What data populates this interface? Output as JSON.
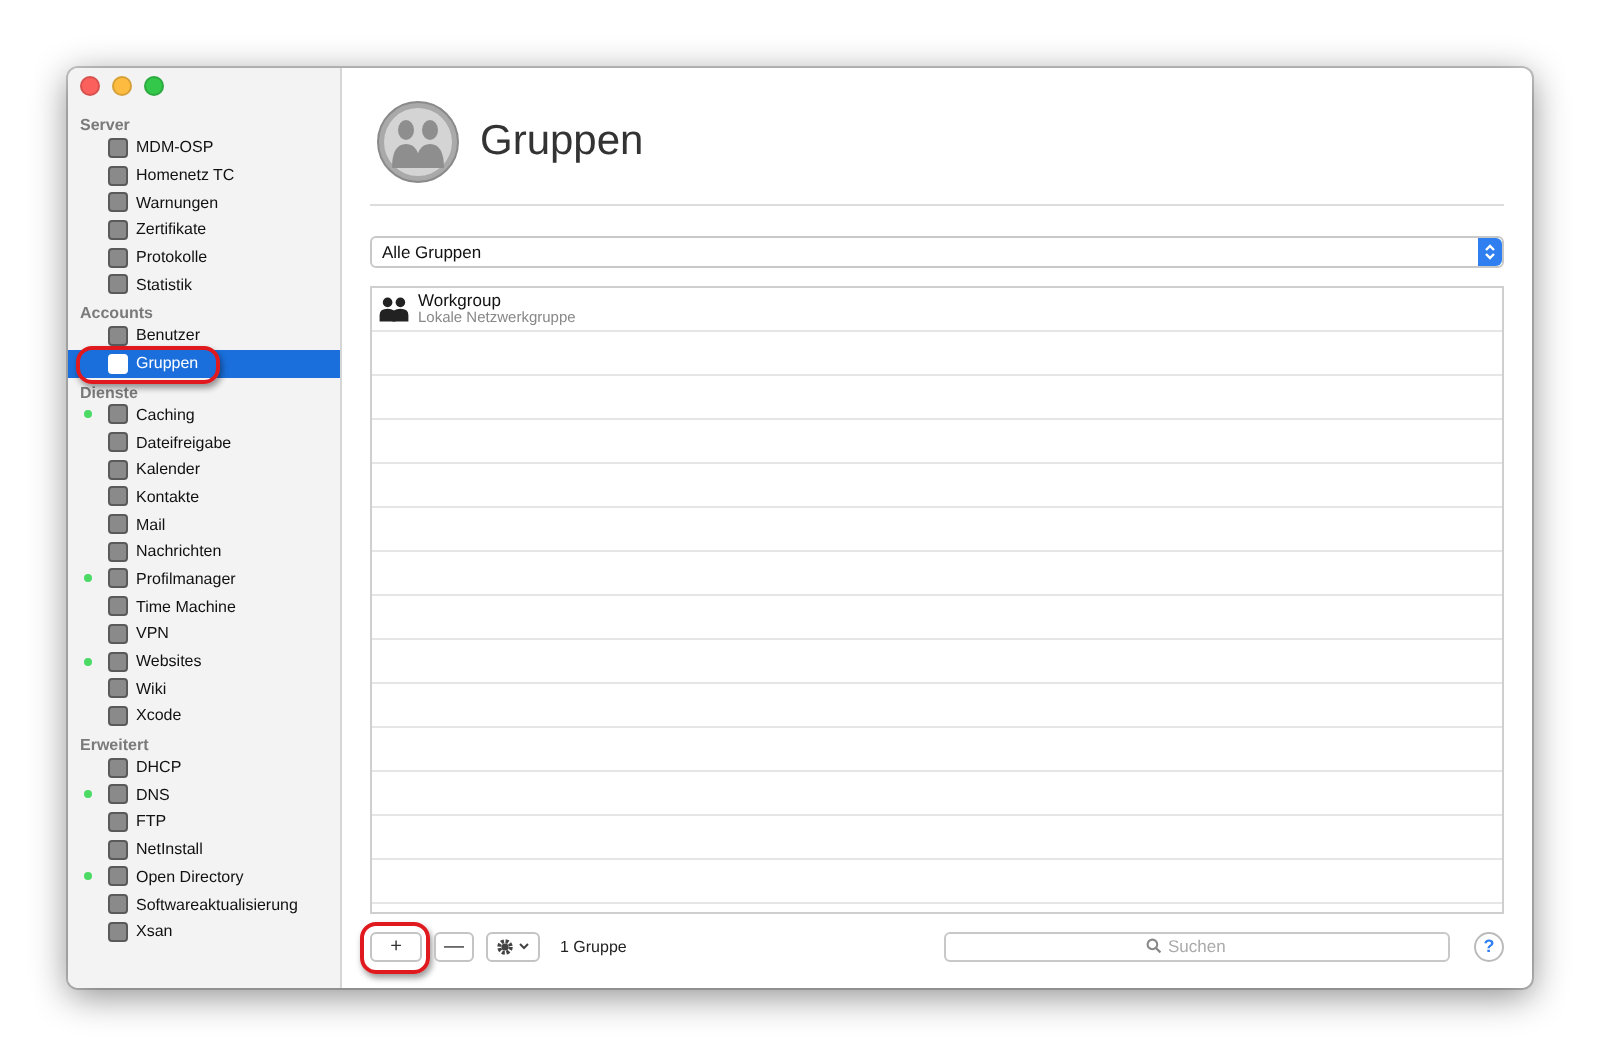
{
  "sidebar": {
    "sections": [
      {
        "title": "Server",
        "items": [
          {
            "label": "MDM-OSP",
            "running": false,
            "selected": false,
            "annotated": false
          },
          {
            "label": "Homenetz TC",
            "running": false,
            "selected": false,
            "annotated": false
          },
          {
            "label": "Warnungen",
            "running": false,
            "selected": false,
            "annotated": false
          },
          {
            "label": "Zertifikate",
            "running": false,
            "selected": false,
            "annotated": false
          },
          {
            "label": "Protokolle",
            "running": false,
            "selected": false,
            "annotated": false
          },
          {
            "label": "Statistik",
            "running": false,
            "selected": false,
            "annotated": false
          }
        ]
      },
      {
        "title": "Accounts",
        "items": [
          {
            "label": "Benutzer",
            "running": false,
            "selected": false,
            "annotated": false
          },
          {
            "label": "Gruppen",
            "running": false,
            "selected": true,
            "annotated": true
          }
        ]
      },
      {
        "title": "Dienste",
        "items": [
          {
            "label": "Caching",
            "running": true,
            "selected": false,
            "annotated": false
          },
          {
            "label": "Dateifreigabe",
            "running": false,
            "selected": false,
            "annotated": false
          },
          {
            "label": "Kalender",
            "running": false,
            "selected": false,
            "annotated": false
          },
          {
            "label": "Kontakte",
            "running": false,
            "selected": false,
            "annotated": false
          },
          {
            "label": "Mail",
            "running": false,
            "selected": false,
            "annotated": false
          },
          {
            "label": "Nachrichten",
            "running": false,
            "selected": false,
            "annotated": false
          },
          {
            "label": "Profilmanager",
            "running": true,
            "selected": false,
            "annotated": false
          },
          {
            "label": "Time Machine",
            "running": false,
            "selected": false,
            "annotated": false
          },
          {
            "label": "VPN",
            "running": false,
            "selected": false,
            "annotated": false
          },
          {
            "label": "Websites",
            "running": true,
            "selected": false,
            "annotated": false
          },
          {
            "label": "Wiki",
            "running": false,
            "selected": false,
            "annotated": false
          },
          {
            "label": "Xcode",
            "running": false,
            "selected": false,
            "annotated": false
          }
        ]
      },
      {
        "title": "Erweitert",
        "items": [
          {
            "label": "DHCP",
            "running": false,
            "selected": false,
            "annotated": false
          },
          {
            "label": "DNS",
            "running": true,
            "selected": false,
            "annotated": false
          },
          {
            "label": "FTP",
            "running": false,
            "selected": false,
            "annotated": false
          },
          {
            "label": "NetInstall",
            "running": false,
            "selected": false,
            "annotated": false
          },
          {
            "label": "Open Directory",
            "running": true,
            "selected": false,
            "annotated": false
          },
          {
            "label": "Softwareaktualisierung",
            "running": false,
            "selected": false,
            "annotated": false
          },
          {
            "label": "Xsan",
            "running": false,
            "selected": false,
            "annotated": false
          }
        ]
      }
    ]
  },
  "page": {
    "title": "Gruppen"
  },
  "filter": {
    "value": "Alle Gruppen"
  },
  "groups": [
    {
      "name": "Workgroup",
      "description": "Lokale Netzwerkgruppe"
    }
  ],
  "footer": {
    "add": {
      "label": "+",
      "annotated": true
    },
    "remove": {
      "label": "—",
      "annotated": false
    },
    "count": "1 Gruppe",
    "search": {
      "placeholder": "Suchen"
    },
    "help": "?"
  }
}
